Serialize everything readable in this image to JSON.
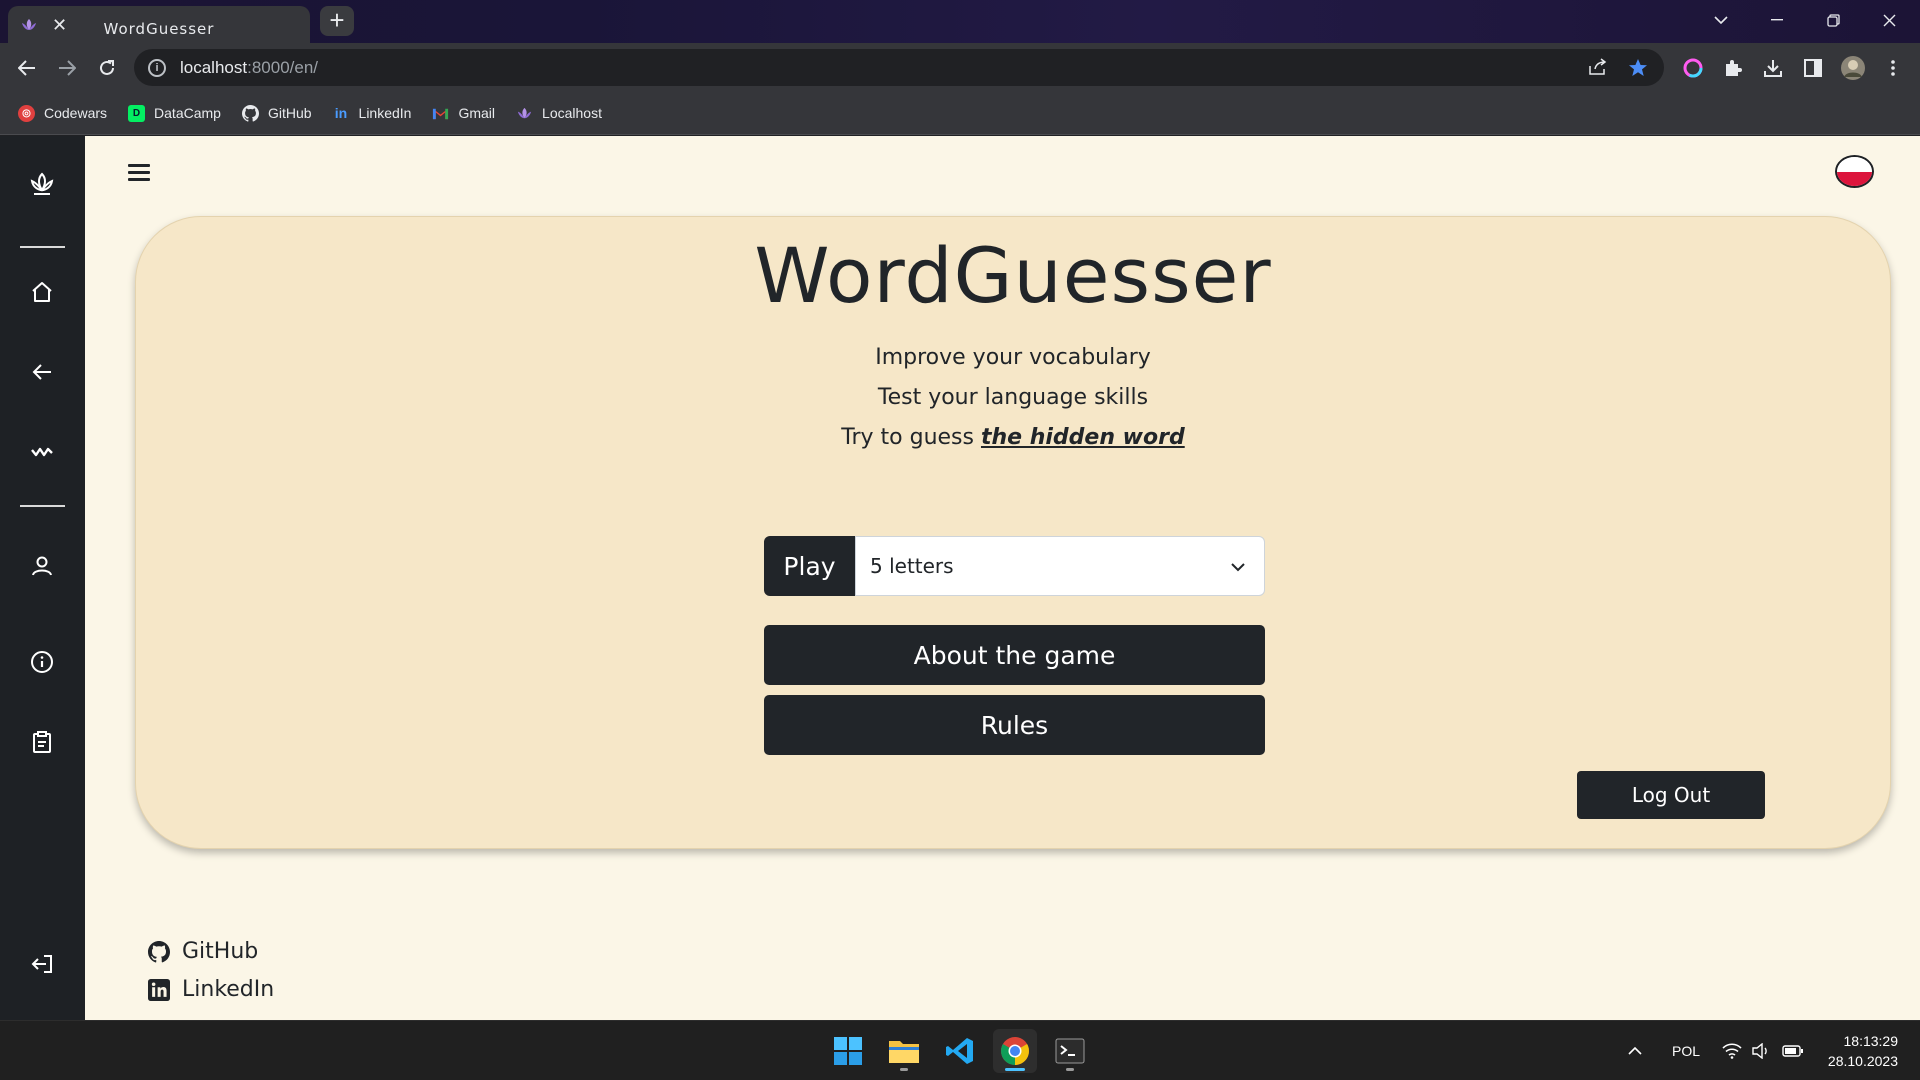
{
  "browser": {
    "tab_title": "WordGuesser",
    "tab_close": "✕",
    "new_tab": "+",
    "url_host": "localhost",
    "url_path": ":8000/en/",
    "bookmarks": [
      {
        "label": "Codewars",
        "color": "#e0403f"
      },
      {
        "label": "DataCamp",
        "color": "#03ef62"
      },
      {
        "label": "GitHub",
        "color": "#e8eaed"
      },
      {
        "label": "LinkedIn",
        "color": "#0a66c2"
      },
      {
        "label": "Gmail",
        "color": "#ea4335"
      },
      {
        "label": "Localhost",
        "color": "#b593e8"
      }
    ]
  },
  "header": {
    "flag_country": "Poland"
  },
  "main": {
    "title": "WordGuesser",
    "line1": "Improve your vocabulary",
    "line2": "Test your language skills",
    "line3_prefix": "Try to guess ",
    "line3_emphasis": "the hidden word",
    "play_label": "Play",
    "letters_selected": "5 letters",
    "about_label": "About the game",
    "rules_label": "Rules",
    "logout_label": "Log Out"
  },
  "footer": {
    "github": "GitHub",
    "linkedin": "LinkedIn"
  },
  "taskbar": {
    "language": "POL",
    "time": "18:13:29",
    "date": "28.10.2023"
  },
  "colors": {
    "page_bg": "#fbf6e7",
    "card_bg": "#f6e7c8",
    "dark": "#212529",
    "sidebar": "#1e2125"
  }
}
